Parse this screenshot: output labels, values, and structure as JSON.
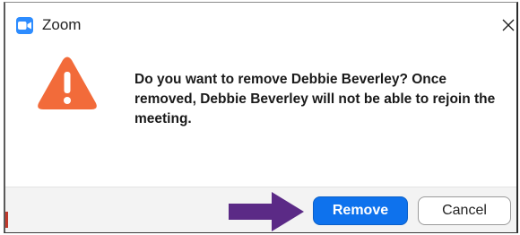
{
  "window": {
    "app_icon": "zoom-camera-icon",
    "title": "Zoom",
    "close_icon": "close-icon"
  },
  "dialog": {
    "icon": "warning-triangle-icon",
    "message": "Do you want to remove Debbie Beverley? Once removed, Debbie Beverley will not be able to rejoin the meeting."
  },
  "buttons": {
    "primary_label": "Remove",
    "secondary_label": "Cancel"
  },
  "annotation": {
    "icon": "pointer-arrow-icon"
  },
  "colors": {
    "accent": "#0e72ed",
    "warning": "#f26b3a",
    "arrow": "#5b2a86"
  }
}
